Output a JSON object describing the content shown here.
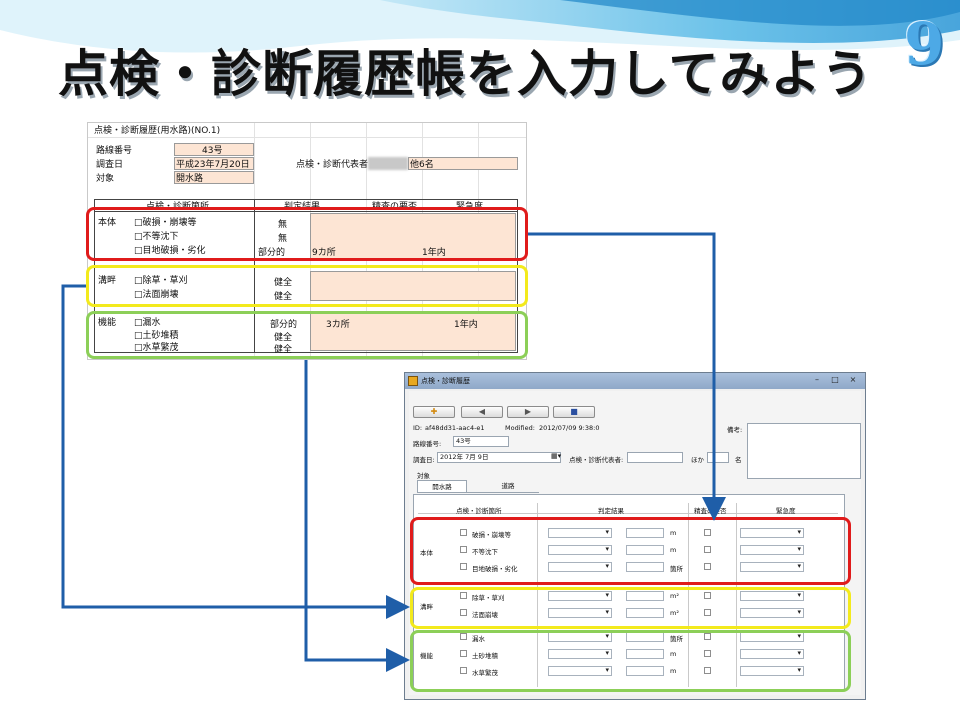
{
  "slide": {
    "title": "点検・診断履歴帳を入力してみよう",
    "number": "9"
  },
  "sheet": {
    "heading": "点検・診断履歴(用水路)(NO.1)",
    "route_label": "路線番号",
    "route_value": "43号",
    "date_label": "調査日",
    "date_value": "平成23年7月20日",
    "rep_label": "点検・診断代表者",
    "rep_value": "他6名",
    "target_label": "対象",
    "target_value": "開水路",
    "col_location": "点検・診断箇所",
    "col_result": "判定結果",
    "col_detail": "精査の要否",
    "col_urgency": "緊急度",
    "groups": [
      {
        "name": "本体",
        "items": [
          {
            "label": "□破損・崩壊等",
            "result": "無",
            "extent": "",
            "urgency": ""
          },
          {
            "label": "□不等沈下",
            "result": "無",
            "extent": "",
            "urgency": ""
          },
          {
            "label": "□目地破損・劣化",
            "result": "部分的",
            "extent": "9カ所",
            "urgency": "1年内"
          }
        ]
      },
      {
        "name": "溝畔",
        "items": [
          {
            "label": "□除草・草刈",
            "result": "健全",
            "extent": "",
            "urgency": ""
          },
          {
            "label": "□法面崩壊",
            "result": "健全",
            "extent": "",
            "urgency": ""
          }
        ]
      },
      {
        "name": "機能",
        "items": [
          {
            "label": "□漏水",
            "result": "部分的",
            "extent": "3カ所",
            "urgency": "1年内"
          },
          {
            "label": "□土砂堆積",
            "result": "健全",
            "extent": "",
            "urgency": ""
          },
          {
            "label": "□水草繁茂",
            "result": "健全",
            "extent": "",
            "urgency": ""
          }
        ]
      }
    ]
  },
  "form": {
    "window_title": "点検・診断履歴",
    "toolbar": {
      "add_icon": "plus-icon",
      "prev_icon": "arrow-left-icon",
      "next_icon": "arrow-right-icon",
      "save_icon": "save-icon"
    },
    "id_label": "ID:",
    "id_value": "af48dd31-aac4-e1",
    "modified_label": "Modified:",
    "modified_value": "2012/07/09 9:38:0",
    "remarks_label": "備考:",
    "route_label": "路線番号:",
    "route_value": "43号",
    "date_label": "調査日:",
    "date_value": "2012年 7月 9日",
    "rep_label": "点検・診断代表者:",
    "others_label": "ほか",
    "people_suffix": "名",
    "target_label": "対象",
    "tabs": [
      {
        "label": "開水路"
      },
      {
        "label": "道路"
      }
    ],
    "col_location": "点検・診断箇所",
    "col_result": "判定結果",
    "col_detail": "精査の要否",
    "col_urgency": "緊急度",
    "groups": [
      {
        "name": "本体",
        "rows": [
          {
            "label": "破損・崩壊等",
            "unit": "m"
          },
          {
            "label": "不等沈下",
            "unit": "m"
          },
          {
            "label": "目地破損・劣化",
            "unit": "箇所"
          }
        ]
      },
      {
        "name": "溝畔",
        "rows": [
          {
            "label": "除草・草刈",
            "unit": "m²"
          },
          {
            "label": "法面崩壊",
            "unit": "m²"
          }
        ]
      },
      {
        "name": "機能",
        "rows": [
          {
            "label": "漏水",
            "unit": "箇所"
          },
          {
            "label": "土砂堆積",
            "unit": "m"
          },
          {
            "label": "水草繁茂",
            "unit": "m"
          }
        ]
      }
    ]
  },
  "colors": {
    "red": "#e01b1b",
    "yellow": "#f3ea1c",
    "green": "#8ccf58",
    "arrow": "#1f5ea8",
    "peach": "#fde5d4"
  }
}
